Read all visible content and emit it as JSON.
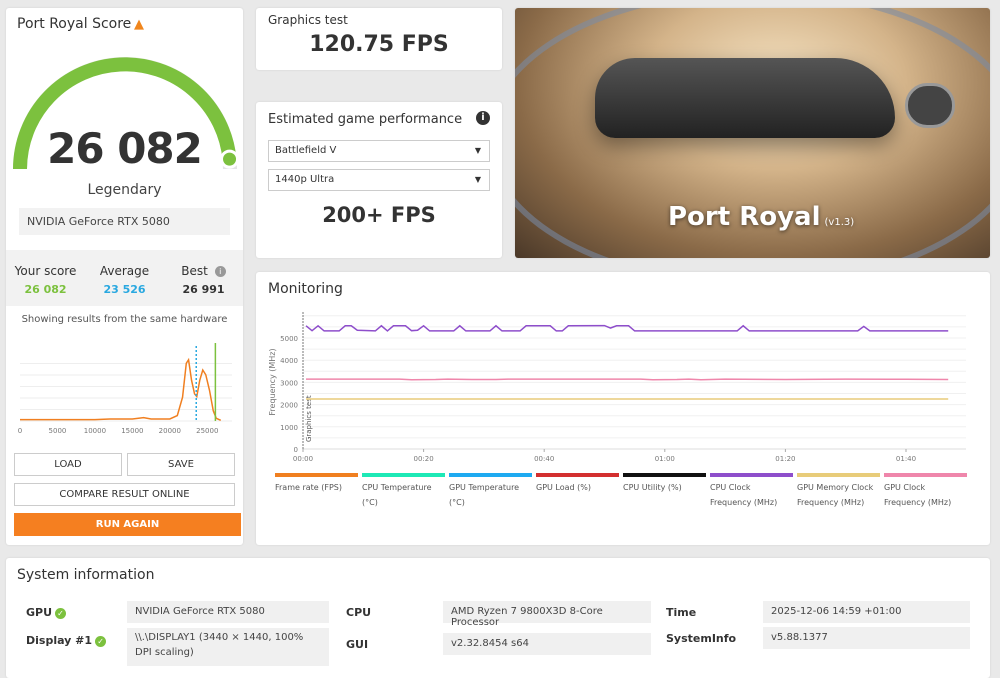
{
  "score_card": {
    "title": "Port Royal Score",
    "warning_icon": "warning-icon",
    "score": "26 082",
    "rank": "Legendary",
    "gpu": "NVIDIA GeForce RTX 5080",
    "gauge_fraction": 0.97,
    "gauge_color": "#7cc13e",
    "stats": [
      {
        "label": "Your score",
        "value": "26 082",
        "color": "#7cc13e"
      },
      {
        "label": "Average",
        "value": "23 526",
        "color": "#29a8e0"
      },
      {
        "label": "Best",
        "value": "26 991",
        "color": "#333333"
      }
    ],
    "same_hw": "Showing results from the same hardware",
    "buttons": {
      "load": "LOAD",
      "save": "SAVE",
      "compare": "COMPARE RESULT ONLINE",
      "run": "RUN AGAIN"
    }
  },
  "hist_chart": {
    "type": "area",
    "x_ticks": [
      0,
      5000,
      10000,
      15000,
      20000,
      25000
    ],
    "xlim": [
      0,
      27500
    ],
    "average": 23526,
    "your_score": 26082,
    "points": [
      [
        0,
        0.02
      ],
      [
        5000,
        0.02
      ],
      [
        10000,
        0.02
      ],
      [
        12000,
        0.03
      ],
      [
        15000,
        0.03
      ],
      [
        16500,
        0.05
      ],
      [
        17500,
        0.03
      ],
      [
        20000,
        0.03
      ],
      [
        21000,
        0.08
      ],
      [
        21700,
        0.35
      ],
      [
        22200,
        0.85
      ],
      [
        22500,
        0.9
      ],
      [
        22900,
        0.6
      ],
      [
        23300,
        0.4
      ],
      [
        23600,
        0.36
      ],
      [
        24000,
        0.6
      ],
      [
        24400,
        0.75
      ],
      [
        24800,
        0.68
      ],
      [
        25300,
        0.45
      ],
      [
        25800,
        0.15
      ],
      [
        26200,
        0.04
      ],
      [
        26800,
        0.01
      ]
    ]
  },
  "graphics_test": {
    "label": "Graphics test",
    "value": "120.75 FPS"
  },
  "estimated": {
    "title": "Estimated game performance",
    "game": "Battlefield V",
    "preset": "1440p Ultra",
    "fps": "200+ FPS"
  },
  "hero": {
    "name": "Port Royal",
    "version": "(v1.3)"
  },
  "monitoring": {
    "title": "Monitoring",
    "chart_data": {
      "type": "line",
      "ylabel": "Frequency (MHz)",
      "marker_label": "Graphics test",
      "y_ticks": [
        0,
        1000,
        2000,
        3000,
        4000,
        5000
      ],
      "ylim": [
        0,
        6000
      ],
      "x_ticks": [
        "00:00",
        "00:20",
        "00:40",
        "01:00",
        "01:20",
        "01:40"
      ],
      "xlim_seconds": [
        0,
        110
      ],
      "legend": [
        {
          "name": "Frame rate (FPS)",
          "color": "#f07f20"
        },
        {
          "name": "CPU Temperature (°C)",
          "color": "#1de9b6"
        },
        {
          "name": "GPU Temperature (°C)",
          "color": "#1eaaf1"
        },
        {
          "name": "GPU Load (%)",
          "color": "#d32f2f"
        },
        {
          "name": "CPU Utility (%)",
          "color": "#111111"
        },
        {
          "name": "CPU Clock Frequency (MHz)",
          "color": "#8e4ecb"
        },
        {
          "name": "GPU Memory Clock Frequency (MHz)",
          "color": "#e8cc7a"
        },
        {
          "name": "GPU Clock Frequency (MHz)",
          "color": "#ef86ab"
        }
      ],
      "series": [
        {
          "name": "CPU Clock Frequency (MHz)",
          "color": "#8e4ecb",
          "points": [
            [
              0.5,
              5550
            ],
            [
              1.5,
              5330
            ],
            [
              2.5,
              5550
            ],
            [
              3.5,
              5320
            ],
            [
              6,
              5320
            ],
            [
              7,
              5550
            ],
            [
              8,
              5550
            ],
            [
              9,
              5350
            ],
            [
              12,
              5320
            ],
            [
              13,
              5550
            ],
            [
              14,
              5320
            ],
            [
              15,
              5550
            ],
            [
              17,
              5550
            ],
            [
              18,
              5330
            ],
            [
              19,
              5350
            ],
            [
              20,
              5550
            ],
            [
              21,
              5320
            ],
            [
              25,
              5320
            ],
            [
              26,
              5550
            ],
            [
              27,
              5320
            ],
            [
              31,
              5320
            ],
            [
              32,
              5550
            ],
            [
              33,
              5320
            ],
            [
              36,
              5320
            ],
            [
              37,
              5550
            ],
            [
              41,
              5550
            ],
            [
              42,
              5320
            ],
            [
              43,
              5320
            ],
            [
              44,
              5550
            ],
            [
              50,
              5560
            ],
            [
              51,
              5450
            ],
            [
              52,
              5550
            ],
            [
              54,
              5550
            ],
            [
              55,
              5320
            ],
            [
              72,
              5320
            ],
            [
              73,
              5550
            ],
            [
              74,
              5320
            ],
            [
              92,
              5320
            ],
            [
              93,
              5520
            ],
            [
              94,
              5320
            ],
            [
              107,
              5320
            ]
          ]
        },
        {
          "name": "GPU Clock Frequency (MHz)",
          "color": "#ef86ab",
          "points": [
            [
              0.5,
              3150
            ],
            [
              16,
              3150
            ],
            [
              18,
              3120
            ],
            [
              22,
              3130
            ],
            [
              24,
              3150
            ],
            [
              28,
              3130
            ],
            [
              32,
              3130
            ],
            [
              34,
              3150
            ],
            [
              56,
              3150
            ],
            [
              58,
              3120
            ],
            [
              62,
              3130
            ],
            [
              64,
              3150
            ],
            [
              66,
              3120
            ],
            [
              70,
              3150
            ],
            [
              80,
              3130
            ],
            [
              90,
              3150
            ],
            [
              100,
              3140
            ],
            [
              107,
              3130
            ]
          ]
        },
        {
          "name": "GPU Memory Clock Frequency (MHz)",
          "color": "#e8cc7a",
          "points": [
            [
              0.5,
              2250
            ],
            [
              107,
              2250
            ]
          ]
        }
      ]
    }
  },
  "system": {
    "title": "System information",
    "rows": [
      {
        "label": "GPU",
        "value": "NVIDIA GeForce RTX 5080",
        "ok": true
      },
      {
        "label": "Display #1",
        "value": "\\\\.\\DISPLAY1 (3440 × 1440, 100% DPI scaling)",
        "ok": true
      },
      {
        "label": "CPU",
        "value": "AMD Ryzen 7 9800X3D 8-Core Processor"
      },
      {
        "label": "GUI",
        "value": "v2.32.8454 s64"
      },
      {
        "label": "Time",
        "value": "2025-12-06 14:59 +01:00"
      },
      {
        "label": "SystemInfo",
        "value": "v5.88.1377"
      }
    ]
  }
}
